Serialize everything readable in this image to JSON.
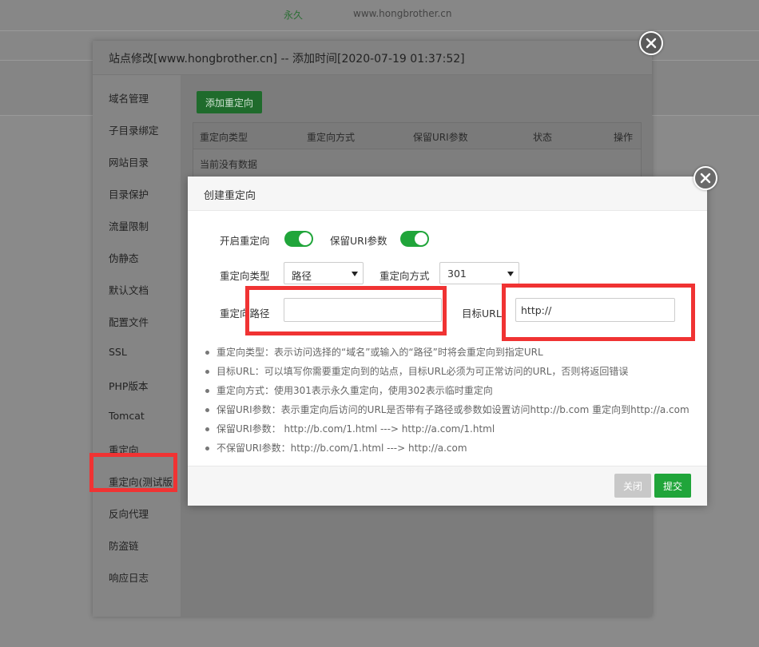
{
  "background": {
    "row_status": "永久",
    "row_domain": "www.hongbrother.cn"
  },
  "outer_dialog": {
    "title": "站点修改[www.hongbrother.cn] -- 添加时间[2020-07-19 01:37:52]",
    "sidebar": [
      {
        "label": "域名管理"
      },
      {
        "label": "子目录绑定"
      },
      {
        "label": "网站目录"
      },
      {
        "label": "目录保护"
      },
      {
        "label": "流量限制"
      },
      {
        "label": "伪静态"
      },
      {
        "label": "默认文档"
      },
      {
        "label": "配置文件"
      },
      {
        "label": "SSL"
      },
      {
        "label": "PHP版本"
      },
      {
        "label": "Tomcat"
      },
      {
        "label": "重定向"
      },
      {
        "label": "重定向(测试版)"
      },
      {
        "label": "反向代理"
      },
      {
        "label": "防盗链"
      },
      {
        "label": "响应日志"
      }
    ],
    "add_button": "添加重定向",
    "table": {
      "headers": [
        "重定向类型",
        "重定向方式",
        "保留URI参数",
        "状态",
        "操作"
      ],
      "empty_text": "当前没有数据"
    }
  },
  "inner_dialog": {
    "title": "创建重定向",
    "enable_redirect_label": "开启重定向",
    "enable_redirect_on": true,
    "keep_uri_label": "保留URI参数",
    "keep_uri_on": true,
    "redirect_type_label": "重定向类型",
    "redirect_type_value": "路径",
    "redirect_method_label": "重定向方式",
    "redirect_method_value": "301",
    "redirect_path_label": "重定向路径",
    "redirect_path_value": "",
    "target_url_label": "目标URL",
    "target_url_value": "http://",
    "notes": [
      "重定向类型：表示访问选择的“域名”或输入的“路径”时将会重定向到指定URL",
      "目标URL：可以填写你需要重定向到的站点，目标URL必须为可正常访问的URL，否则将返回错误",
      "重定向方式：使用301表示永久重定向，使用302表示临时重定向",
      "保留URI参数：表示重定向后访问的URL是否带有子路径或参数如设置访问http://b.com 重定向到http://a.com",
      "保留URI参数：  http://b.com/1.html ---> http://a.com/1.html",
      "不保留URI参数：http://b.com/1.html ---> http://a.com"
    ],
    "close_button": "关闭",
    "submit_button": "提交"
  },
  "colors": {
    "accent_green": "#20a53a",
    "highlight_red": "#f03333"
  }
}
